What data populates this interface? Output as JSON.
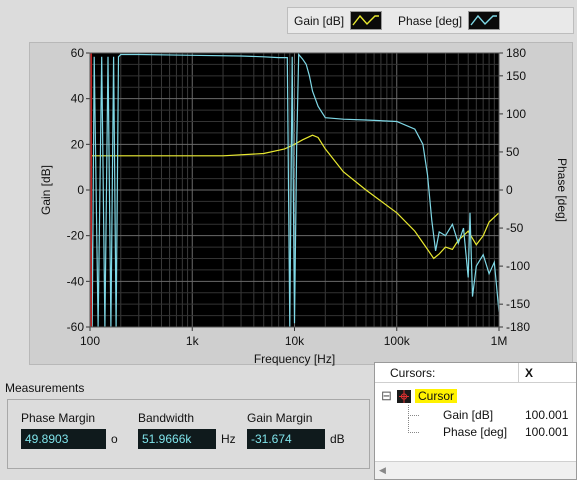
{
  "legend": {
    "gain_label": "Gain [dB]",
    "phase_label": "Phase [deg]"
  },
  "chart_data": {
    "type": "line",
    "xscale": "log",
    "xlabel": "Frequency [Hz]",
    "ylabel": "Gain [dB]",
    "y2label": "Phase [deg]",
    "xlim": [
      100,
      1000000
    ],
    "ylim": [
      -60,
      60
    ],
    "y2lim": [
      -180,
      180
    ],
    "xticks": [
      "100",
      "1k",
      "10k",
      "100k",
      "1M"
    ],
    "yticks": [
      "60",
      "40",
      "20",
      "0",
      "-20",
      "-40",
      "-60"
    ],
    "y2ticks": [
      "180",
      "150",
      "100",
      "50",
      "0",
      "-50",
      "-100",
      "-150",
      "-180"
    ],
    "grid": true,
    "series": [
      {
        "name": "Gain [dB]",
        "color": "#e8e830",
        "axis": "left",
        "x": [
          100,
          200,
          500,
          1000,
          2000,
          5000,
          8000,
          10000,
          12000,
          15000,
          17000,
          20000,
          30000,
          50000,
          100000,
          150000,
          200000,
          230000,
          260000,
          300000,
          350000,
          400000,
          450000,
          500000,
          600000,
          700000,
          800000,
          1000000
        ],
        "y": [
          15,
          15,
          15,
          15,
          15,
          16,
          18,
          20,
          22,
          24,
          23,
          18,
          8,
          0,
          -10,
          -18,
          -26,
          -30,
          -28,
          -25,
          -26,
          -22,
          -20,
          -18,
          -24,
          -20,
          -14,
          -10
        ]
      },
      {
        "name": "Phase [deg]",
        "color": "#7fd8e6",
        "axis": "right",
        "x": [
          100,
          105,
          110,
          120,
          130,
          140,
          150,
          160,
          170,
          180,
          190,
          200,
          300,
          1000,
          3000,
          5000,
          7000,
          8500,
          9000,
          9500,
          10000,
          10500,
          11000,
          12000,
          13000,
          14000,
          15000,
          17000,
          20000,
          30000,
          50000,
          100000,
          150000,
          180000,
          200000,
          220000,
          240000,
          260000,
          300000,
          350000,
          400000,
          450000,
          500000,
          520000,
          550000,
          600000,
          700000,
          800000,
          900000,
          1000000
        ],
        "y": [
          175,
          -180,
          175,
          -180,
          175,
          -180,
          175,
          -180,
          175,
          -180,
          175,
          178,
          178,
          177,
          176,
          175,
          174,
          174,
          -180,
          175,
          -175,
          60,
          178,
          172,
          165,
          150,
          130,
          110,
          95,
          93,
          92,
          90,
          80,
          60,
          20,
          -40,
          -80,
          -55,
          -60,
          -45,
          -70,
          -50,
          -115,
          -30,
          -140,
          -100,
          -85,
          -110,
          -95,
          -160
        ]
      }
    ]
  },
  "measurements": {
    "title": "Measurements",
    "phase_margin": {
      "label": "Phase Margin",
      "value": "49.8903",
      "unit": "o"
    },
    "bandwidth": {
      "label": "Bandwidth",
      "value": "51.9666k",
      "unit": "Hz"
    },
    "gain_margin": {
      "label": "Gain Margin",
      "value": "-31.674",
      "unit": "dB"
    }
  },
  "cursors": {
    "header_name": "Cursors:",
    "header_x": "X",
    "expand_symbol": "⊟",
    "cursor_name": "Cursor",
    "rows": [
      {
        "name": "Gain [dB]",
        "x": "100.001"
      },
      {
        "name": "Phase [deg]",
        "x": "100.001"
      }
    ]
  }
}
